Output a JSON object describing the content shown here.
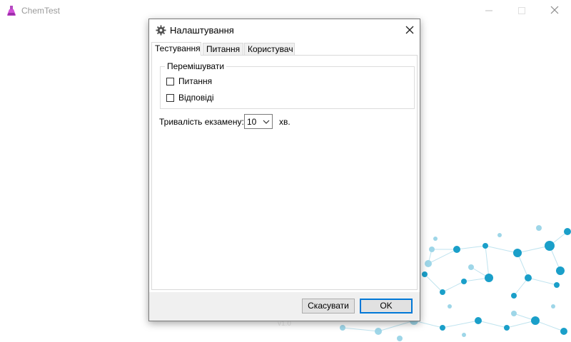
{
  "app": {
    "title": "ChemTest",
    "version": "v1.0"
  },
  "dialog": {
    "title": "Налаштування",
    "tabs": [
      {
        "label": "Тестування",
        "active": true
      },
      {
        "label": "Питання",
        "active": false
      },
      {
        "label": "Користувач",
        "active": false
      }
    ],
    "shuffle_group": {
      "legend": "Перемішувати",
      "options": [
        {
          "label": "Питання",
          "checked": false
        },
        {
          "label": "Відповіді",
          "checked": false
        }
      ]
    },
    "duration": {
      "label": "Тривалість екзамену:",
      "value": "10",
      "unit": "хв."
    },
    "buttons": {
      "cancel": "Скасувати",
      "ok": "OK"
    }
  },
  "colors": {
    "accent": "#0078d7",
    "molecule_primary": "#1a9fc9",
    "molecule_light": "#9ed6e8"
  },
  "icons": {
    "app": "flask-icon",
    "settings": "gear-icon"
  }
}
